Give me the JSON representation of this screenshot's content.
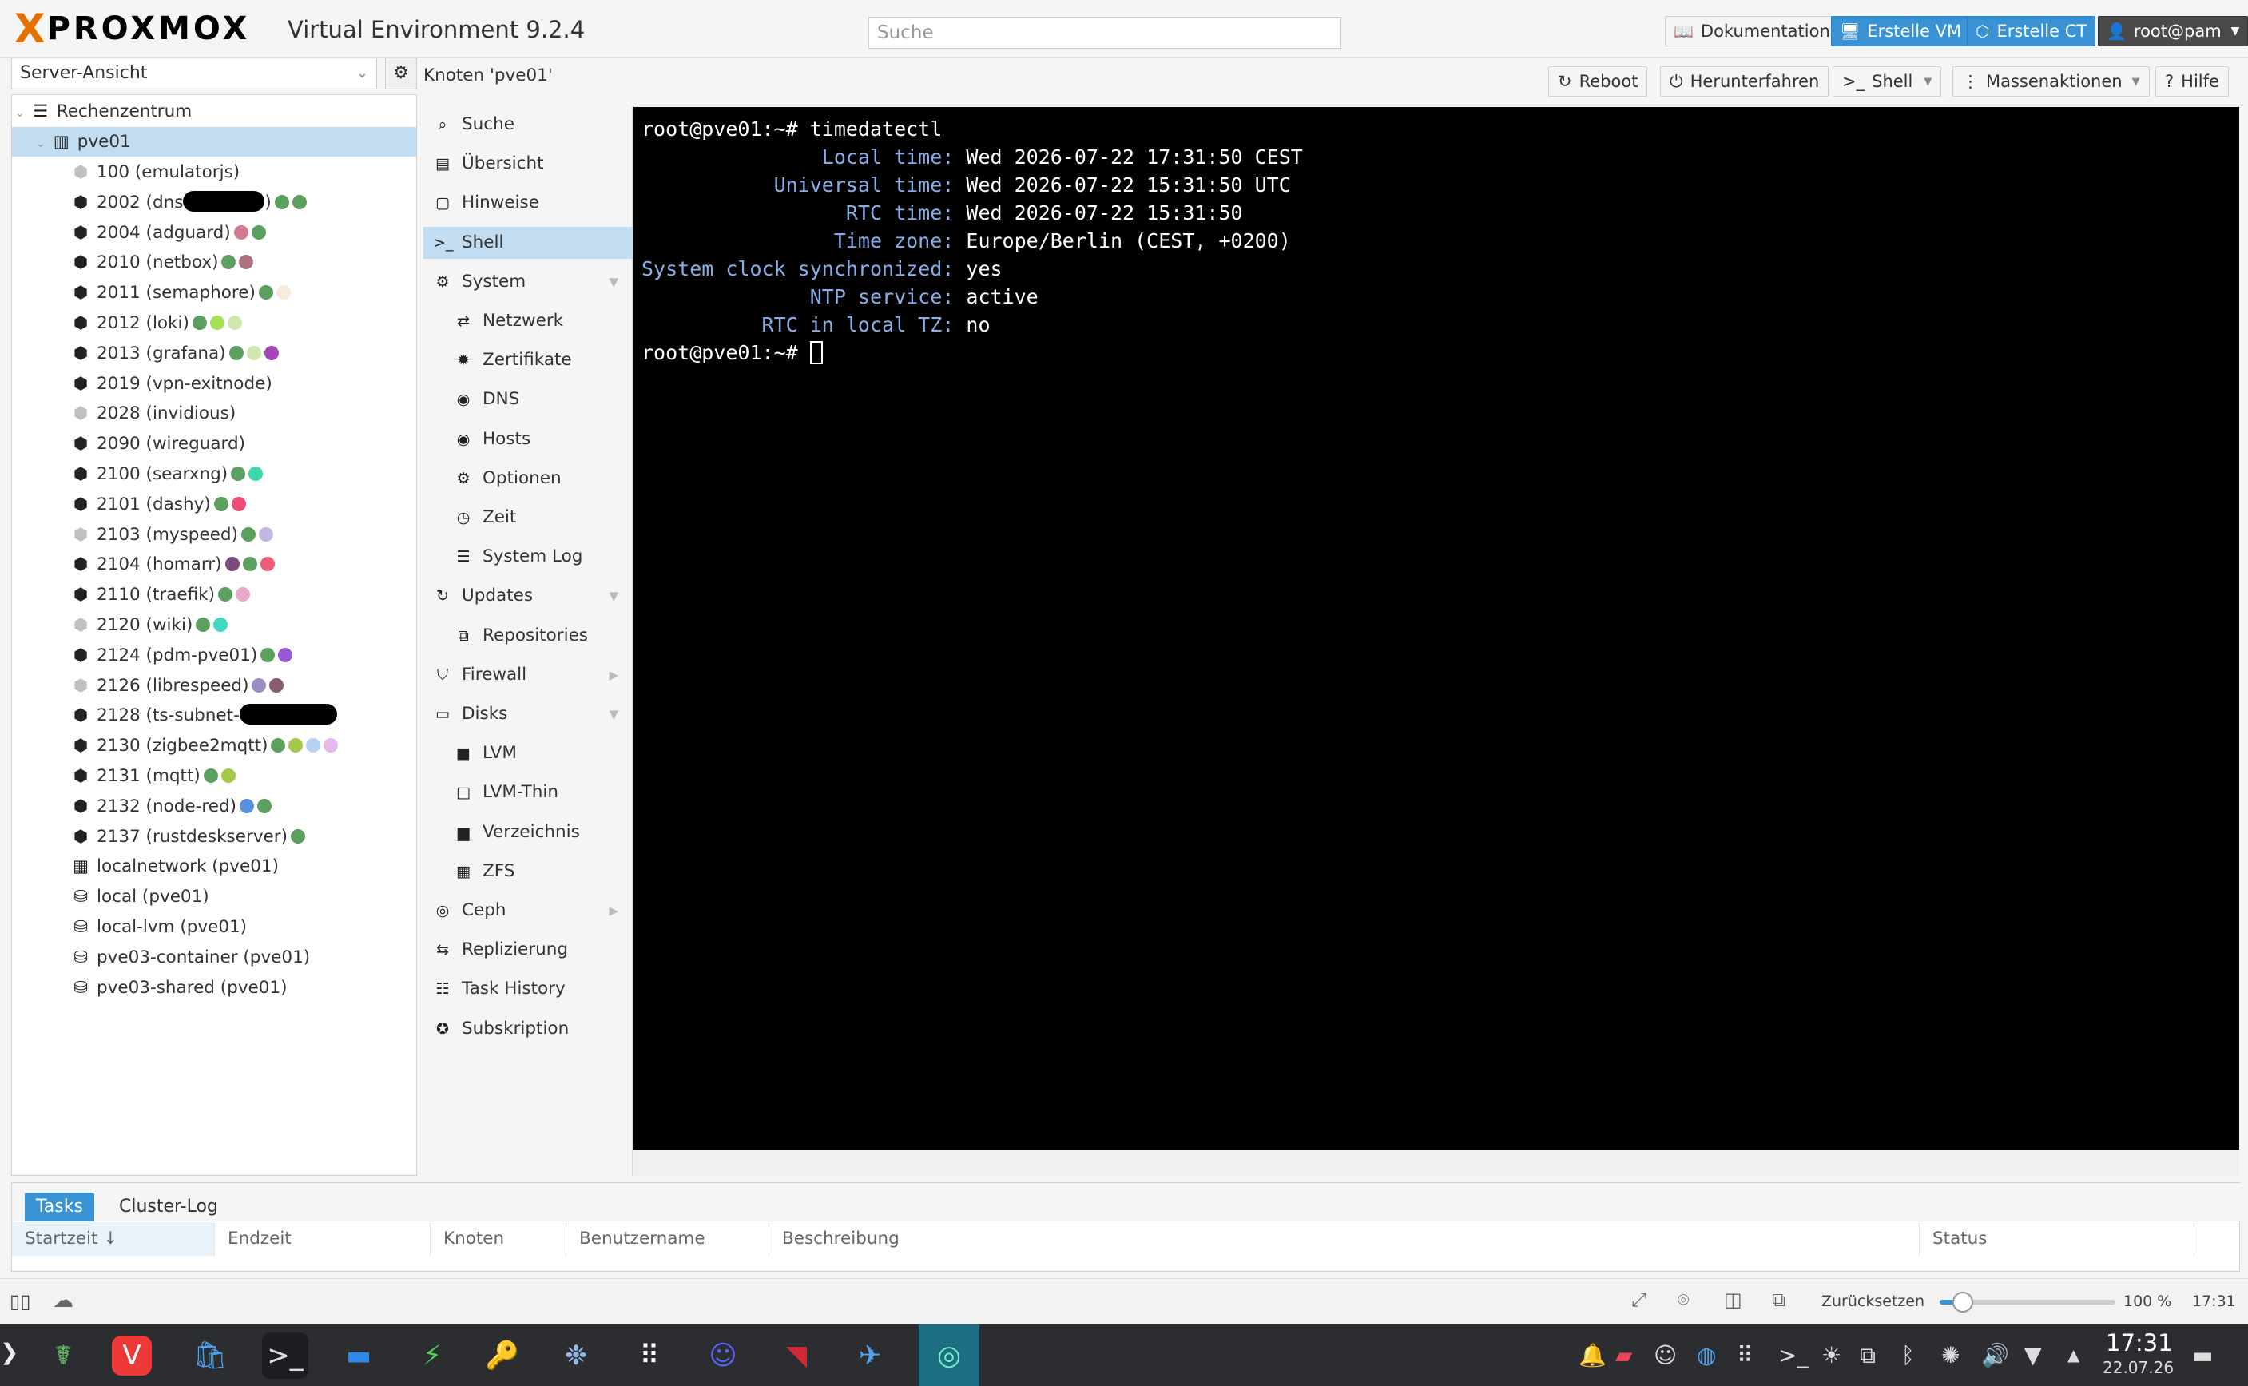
{
  "header": {
    "logo_x": "X",
    "logo_word": "PROXMOX",
    "title": "Virtual Environment 9.2.4",
    "search_placeholder": "Suche",
    "docs_label": "Dokumentation",
    "create_vm_label": "Erstelle VM",
    "create_ct_label": "Erstelle CT",
    "user_label": "root@pam"
  },
  "tree": {
    "view_label": "Server-Ansicht",
    "datacenter": "Rechenzentrum",
    "node": "pve01",
    "items": [
      {
        "label": "100 (emulatorjs)",
        "template": true,
        "dots": []
      },
      {
        "label": "2002 (dns",
        "template": false,
        "dots": [
          "#5ba05e",
          "#5ba05e"
        ],
        "masked": true,
        "suffix": ")"
      },
      {
        "label": "2004 (adguard)",
        "template": false,
        "dots": [
          "#d27a8f",
          "#5ba05e"
        ]
      },
      {
        "label": "2010 (netbox)",
        "template": false,
        "dots": [
          "#5ba05e",
          "#b0707e"
        ]
      },
      {
        "label": "2011 (semaphore)",
        "template": false,
        "dots": [
          "#5ba05e",
          "#f7ecdc"
        ]
      },
      {
        "label": "2012 (loki)",
        "template": false,
        "dots": [
          "#5ba05e",
          "#a6e05a",
          "#cfe8b0"
        ]
      },
      {
        "label": "2013 (grafana)",
        "template": false,
        "dots": [
          "#5ba05e",
          "#cfe8b0",
          "#a545b8"
        ]
      },
      {
        "label": "2019 (vpn-exitnode)",
        "template": false,
        "dots": []
      },
      {
        "label": "2028 (invidious)",
        "template": true,
        "dots": []
      },
      {
        "label": "2090 (wireguard)",
        "template": false,
        "dots": []
      },
      {
        "label": "2100 (searxng)",
        "template": false,
        "dots": [
          "#5ba05e",
          "#3fd8a8"
        ]
      },
      {
        "label": "2101 (dashy)",
        "template": false,
        "dots": [
          "#5ba05e",
          "#ee4d7a"
        ]
      },
      {
        "label": "2103 (myspeed)",
        "template": true,
        "dots": [
          "#5ba05e",
          "#c4b6dc"
        ]
      },
      {
        "label": "2104 (homarr)",
        "template": false,
        "dots": [
          "#7a4a78",
          "#5ba05e",
          "#ee5a7a"
        ]
      },
      {
        "label": "2110 (traefik)",
        "template": false,
        "dots": [
          "#5ba05e",
          "#e6a9c8"
        ]
      },
      {
        "label": "2120 (wiki)",
        "template": true,
        "dots": [
          "#5ba05e",
          "#3fd8c0"
        ]
      },
      {
        "label": "2124 (pdm-pve01)",
        "template": false,
        "dots": [
          "#5ba05e",
          "#9a57d6"
        ]
      },
      {
        "label": "2126 (librespeed)",
        "template": true,
        "dots": [
          "#9b8cc4",
          "#8a5a6e"
        ]
      },
      {
        "label": "2128 (ts-subnet-",
        "template": false,
        "dots": [],
        "masked": true
      },
      {
        "label": "2130 (zigbee2mqtt)",
        "template": false,
        "dots": [
          "#5ba05e",
          "#a6c84a",
          "#b7d2f0",
          "#e5b8ee"
        ]
      },
      {
        "label": "2131 (mqtt)",
        "template": false,
        "dots": [
          "#5ba05e",
          "#a6c84a"
        ]
      },
      {
        "label": "2132 (node-red)",
        "template": false,
        "dots": [
          "#5b8fe0",
          "#5ba05e"
        ]
      },
      {
        "label": "2137 (rustdeskserver)",
        "template": false,
        "dots": [
          "#5ba05e"
        ]
      },
      {
        "label": "localnetwork (pve01)",
        "type": "network",
        "dots": []
      },
      {
        "label": "local (pve01)",
        "type": "storage",
        "dots": []
      },
      {
        "label": "local-lvm (pve01)",
        "type": "storage",
        "dots": []
      },
      {
        "label": "pve03-container (pve01)",
        "type": "storage",
        "dots": []
      },
      {
        "label": "pve03-shared (pve01)",
        "type": "storage",
        "dots": []
      }
    ]
  },
  "content": {
    "title": "Knoten 'pve01'",
    "reboot_label": "Reboot",
    "shutdown_label": "Herunterfahren",
    "shell_label": "Shell",
    "bulk_label": "Massenaktionen",
    "help_label": "Hilfe"
  },
  "menu": [
    {
      "label": "Suche",
      "icon": "⌕",
      "indent": false
    },
    {
      "label": "Übersicht",
      "icon": "▤",
      "indent": false
    },
    {
      "label": "Hinweise",
      "icon": "▢",
      "indent": false
    },
    {
      "label": "Shell",
      "icon": ">_",
      "indent": false,
      "selected": true
    },
    {
      "label": "System",
      "icon": "⚙",
      "indent": false,
      "arrow": "▼"
    },
    {
      "label": "Netzwerk",
      "icon": "⇄",
      "indent": true
    },
    {
      "label": "Zertifikate",
      "icon": "✹",
      "indent": true
    },
    {
      "label": "DNS",
      "icon": "◉",
      "indent": true
    },
    {
      "label": "Hosts",
      "icon": "◉",
      "indent": true
    },
    {
      "label": "Optionen",
      "icon": "⚙",
      "indent": true
    },
    {
      "label": "Zeit",
      "icon": "◷",
      "indent": true
    },
    {
      "label": "System Log",
      "icon": "☰",
      "indent": true
    },
    {
      "label": "Updates",
      "icon": "↻",
      "indent": false,
      "arrow": "▼"
    },
    {
      "label": "Repositories",
      "icon": "⧉",
      "indent": true
    },
    {
      "label": "Firewall",
      "icon": "⛉",
      "indent": false,
      "arrow": "▶"
    },
    {
      "label": "Disks",
      "icon": "▭",
      "indent": false,
      "arrow": "▼"
    },
    {
      "label": "LVM",
      "icon": "■",
      "indent": true
    },
    {
      "label": "LVM-Thin",
      "icon": "□",
      "indent": true
    },
    {
      "label": "Verzeichnis",
      "icon": "▆",
      "indent": true
    },
    {
      "label": "ZFS",
      "icon": "▦",
      "indent": true
    },
    {
      "label": "Ceph",
      "icon": "◎",
      "indent": false,
      "arrow": "▶"
    },
    {
      "label": "Replizierung",
      "icon": "⇆",
      "indent": false
    },
    {
      "label": "Task History",
      "icon": "☷",
      "indent": false
    },
    {
      "label": "Subskription",
      "icon": "✪",
      "indent": false
    }
  ],
  "terminal": {
    "lines": [
      {
        "key": "",
        "value": "root@pve01:~# timedatectl"
      },
      {
        "key": "               Local time:",
        "value": " Wed 2026-07-22 17:31:50 CEST"
      },
      {
        "key": "           Universal time:",
        "value": " Wed 2026-07-22 15:31:50 UTC"
      },
      {
        "key": "                 RTC time:",
        "value": " Wed 2026-07-22 15:31:50"
      },
      {
        "key": "                Time zone:",
        "value": " Europe/Berlin (CEST, +0200)"
      },
      {
        "key": "System clock synchronized:",
        "value": " yes"
      },
      {
        "key": "              NTP service:",
        "value": " active"
      },
      {
        "key": "          RTC in local TZ:",
        "value": " no"
      }
    ],
    "prompt": "root@pve01:~# "
  },
  "bottom": {
    "tab_tasks": "Tasks",
    "tab_cluster": "Cluster-Log",
    "columns": [
      "Startzeit ↓",
      "Endzeit",
      "Knoten",
      "Benutzername",
      "Beschreibung",
      "Status"
    ]
  },
  "statusbar": {
    "reset_label": "Zurücksetzen",
    "zoom": "100 %",
    "zoom_fraction": 0.13,
    "time": "17:31"
  },
  "taskbar": {
    "clock_time": "17:31",
    "clock_date": "22.07.26"
  },
  "colors": {
    "accent": "#3892d4",
    "selection": "#c2ddf2",
    "proxmox_orange": "#e57000",
    "terminal_key": "#88aee8"
  }
}
